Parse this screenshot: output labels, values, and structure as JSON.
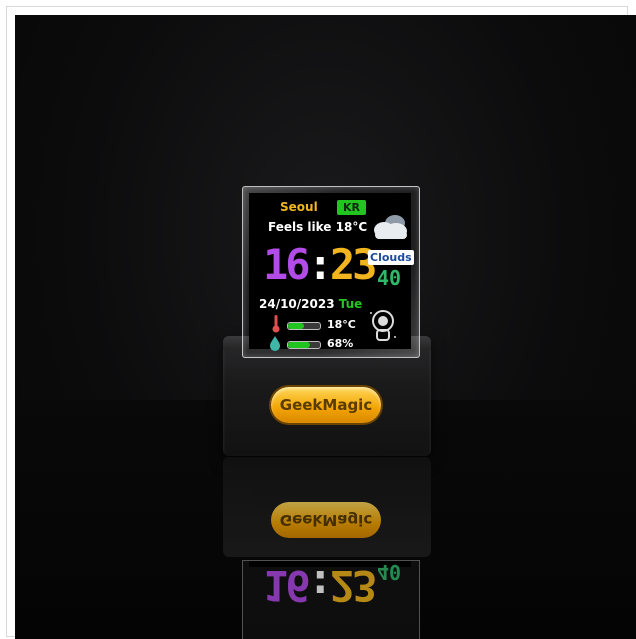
{
  "device": {
    "brand_label": "GeekMagic",
    "screen": {
      "city": "Seoul",
      "country_code": "KR",
      "feels_like": "Feels like 18°C",
      "time_hours": "16",
      "time_colon": ":",
      "time_minutes": "23",
      "condition": "Clouds",
      "condition_value": "40",
      "date": "24/10/2023",
      "weekday": "Tue",
      "temperature": "18°C",
      "humidity": "68%",
      "temperature_level": 0.5,
      "humidity_level": 0.68,
      "icons": [
        "cloud-icon",
        "thermometer-icon",
        "water-drop-icon",
        "astronaut-icon"
      ]
    }
  },
  "colors": {
    "city": "#f2b51d",
    "country_badge": "#22c41f",
    "hours": "#b24be8",
    "minutes": "#f2b51d",
    "weekday": "#22c41f",
    "badge_gold": "#f2a300"
  }
}
